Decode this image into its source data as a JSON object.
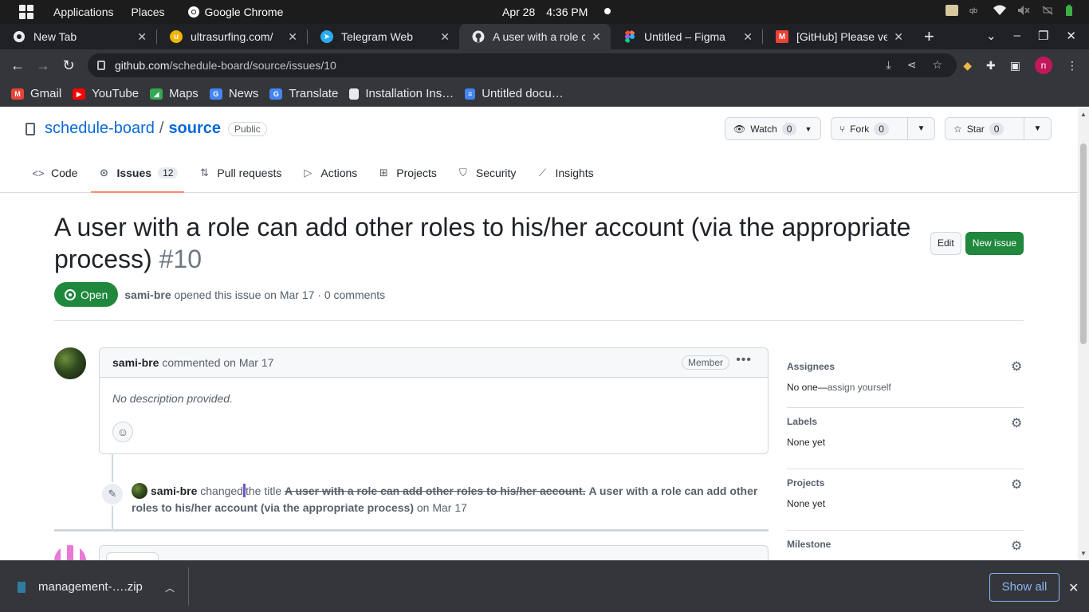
{
  "os_bar": {
    "applications": "Applications",
    "places": "Places",
    "chrome": "Google Chrome",
    "date": "Apr 28",
    "time": "4:36 PM"
  },
  "tabs": [
    {
      "title": "New Tab",
      "icon": "chrome-icon",
      "color": "#9aa0a6"
    },
    {
      "title": "ultrasurfing.com/",
      "icon": "ultrasurf-icon",
      "color": "#f0b400"
    },
    {
      "title": "Telegram Web",
      "icon": "telegram-icon",
      "color": "#2aabee"
    },
    {
      "title": "A user with a role c",
      "icon": "github-icon",
      "color": "#e8eaed",
      "active": true
    },
    {
      "title": "Untitled – Figma",
      "icon": "figma-icon",
      "color": "#f24e1e"
    },
    {
      "title": "[GitHub] Please ve",
      "icon": "gmail-icon",
      "color": "#ea4335"
    }
  ],
  "address": {
    "host": "github.com",
    "path": "/schedule-board/source/issues/10"
  },
  "bookmarks": [
    {
      "label": "Gmail",
      "icon": "gmail-icon",
      "color": "#ea4335"
    },
    {
      "label": "YouTube",
      "icon": "youtube-icon",
      "color": "#ff0000"
    },
    {
      "label": "Maps",
      "icon": "maps-icon",
      "color": "#34a853"
    },
    {
      "label": "News",
      "icon": "news-icon",
      "color": "#4285f4"
    },
    {
      "label": "Translate",
      "icon": "translate-icon",
      "color": "#4285f4"
    },
    {
      "label": "Installation Ins…",
      "icon": "page-icon",
      "color": "#e8eaed"
    },
    {
      "label": "Untitled docu…",
      "icon": "docs-icon",
      "color": "#4285f4"
    }
  ],
  "repo": {
    "owner": "schedule-board",
    "name": "source",
    "visibility": "Public",
    "watch_label": "Watch",
    "watch_count": "0",
    "fork_label": "Fork",
    "fork_count": "0",
    "star_label": "Star",
    "star_count": "0"
  },
  "repo_tabs": [
    {
      "label": "Code",
      "icon": "code-icon"
    },
    {
      "label": "Issues",
      "icon": "issue-icon",
      "count": "12",
      "selected": true
    },
    {
      "label": "Pull requests",
      "icon": "pull-request-icon"
    },
    {
      "label": "Actions",
      "icon": "play-icon"
    },
    {
      "label": "Projects",
      "icon": "table-icon"
    },
    {
      "label": "Security",
      "icon": "shield-icon"
    },
    {
      "label": "Insights",
      "icon": "graph-icon"
    }
  ],
  "issue": {
    "title": "A user with a role can add other roles to his/her account (via the appropriate process)",
    "number": "#10",
    "edit_label": "Edit",
    "new_issue_label": "New issue",
    "state": "Open",
    "author": "sami-bre",
    "opened_text": "opened this issue on Mar 17 · 0 comments"
  },
  "comment": {
    "author": "sami-bre",
    "action": "commented on Mar 17",
    "badge": "Member",
    "body": "No description provided."
  },
  "event": {
    "author": "sami-bre",
    "action_before": "changed",
    "action_after": "the title",
    "old_title": "A user with a role can add other roles to his/her account.",
    "new_title": "A user with a role can add other roles to his/her account (via the appropriate process)",
    "date": "on Mar 17"
  },
  "sidebar": {
    "assignees_title": "Assignees",
    "assignees_value": "No one—",
    "assign_yourself": "assign yourself",
    "labels_title": "Labels",
    "labels_value": "None yet",
    "projects_title": "Projects",
    "projects_value": "None yet",
    "milestone_title": "Milestone"
  },
  "downloads": {
    "file": "management-….zip",
    "show_all": "Show all"
  }
}
